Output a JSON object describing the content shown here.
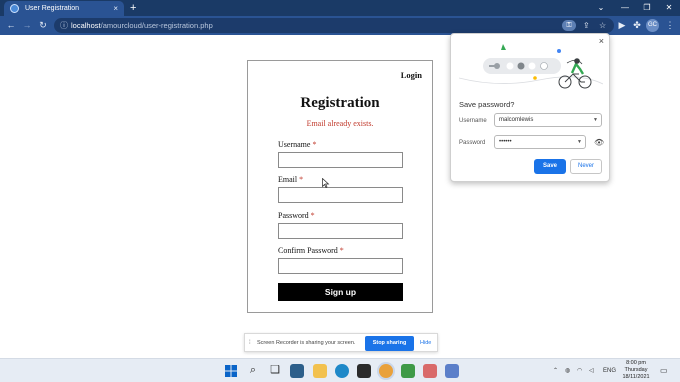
{
  "browser": {
    "tab_title": "User Registration",
    "tab_close": "×",
    "new_tab": "+",
    "url_host": "localhost",
    "url_path": "/amourcloud/user-registration.php",
    "profile_initials": "GC",
    "window_controls": {
      "chevron": "⌄",
      "minimize": "—",
      "restore": "❐",
      "close": "✕"
    }
  },
  "form": {
    "login_link": "Login",
    "title": "Registration",
    "error": "Email already exists.",
    "fields": [
      {
        "label": "Username",
        "required": "*",
        "value": ""
      },
      {
        "label": "Email",
        "required": "*",
        "value": ""
      },
      {
        "label": "Password",
        "required": "*",
        "value": ""
      },
      {
        "label": "Confirm Password",
        "required": "*",
        "value": ""
      }
    ],
    "signup_label": "Sign up"
  },
  "password_popup": {
    "title": "Save password?",
    "username_label": "Username",
    "username_value": "malcomlewis",
    "password_label": "Password",
    "password_value": "••••••",
    "save_label": "Save",
    "never_label": "Never",
    "close": "×"
  },
  "sharebar": {
    "text": "Screen Recorder is sharing your screen.",
    "stop_label": "Stop sharing",
    "hide_label": "Hide"
  },
  "taskbar": {
    "language": "ENG",
    "time": "8:00 pm",
    "day": "Thursday",
    "date": "18/11/2021"
  },
  "colors": {
    "tab_bar": "#1a3a66",
    "toolbar": "#2a5393",
    "accent_blue": "#1a73e8",
    "error_red": "#c0392b",
    "signup_black": "#000000"
  }
}
